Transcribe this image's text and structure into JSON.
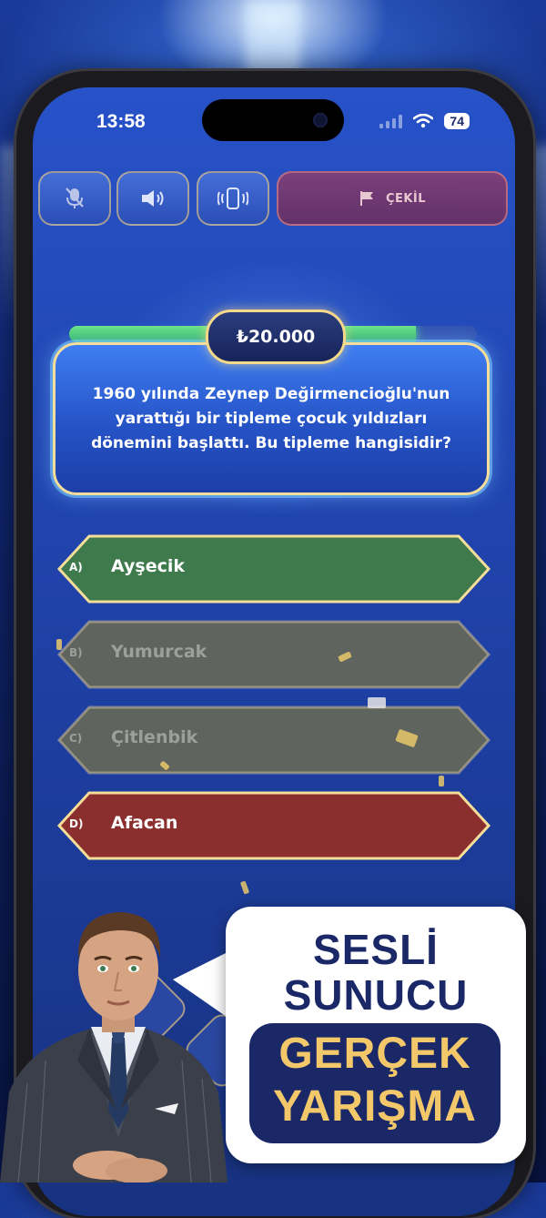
{
  "status_bar": {
    "time": "13:58",
    "battery": "74"
  },
  "toolbar": {
    "mic_icon": "mic-off-icon",
    "sound_icon": "speaker-icon",
    "vibrate_icon": "vibrate-icon",
    "quit_icon": "flag-icon",
    "quit_label": "ÇEKİL"
  },
  "question": {
    "prize": "₺20.000",
    "progress": 0.85,
    "text": "1960 yılında Zeynep Değirmencioğlu'nun yarattığı bir tipleme çocuk yıldızları dönemini başlattı. Bu tipleme hangisidir?"
  },
  "answers": [
    {
      "letter": "A)",
      "text": "Ayşecik",
      "state": "correct"
    },
    {
      "letter": "B)",
      "text": "Yumurcak",
      "state": "disabled"
    },
    {
      "letter": "C)",
      "text": "Çitlenbik",
      "state": "disabled"
    },
    {
      "letter": "D)",
      "text": "Afacan",
      "state": "wrong"
    }
  ],
  "promo": {
    "line1": "SESLİ",
    "line2": "SUNUCU",
    "line3": "GERÇEK",
    "line4": "YARIŞMA"
  },
  "colors": {
    "correct": "#3f7a4d",
    "wrong": "#8a2f2e",
    "disabled": "#6b6b52",
    "accent": "#f5dd9a"
  }
}
